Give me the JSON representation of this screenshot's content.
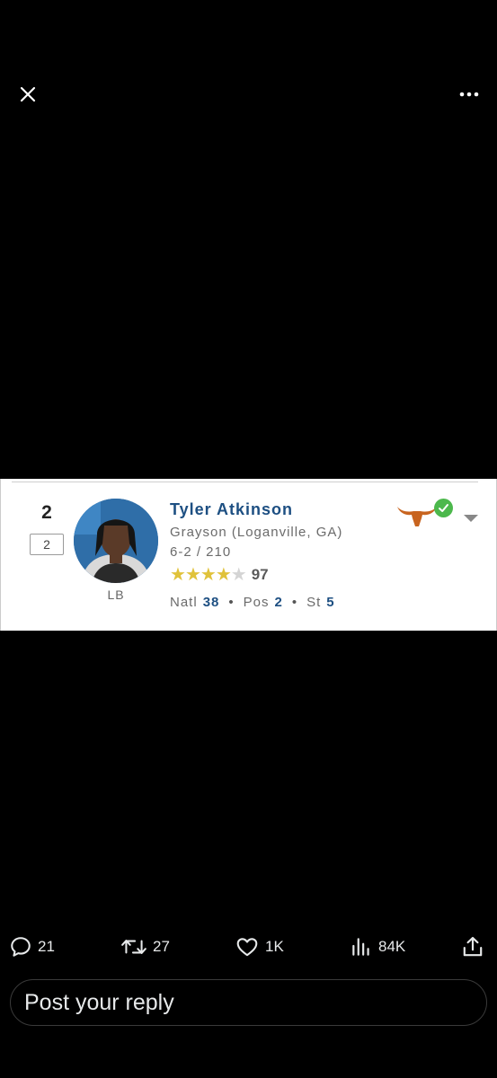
{
  "icons": {
    "close": "close-icon",
    "more": "more-horizontal-icon",
    "reply": "reply-bubble-icon",
    "retweet": "retweet-icon",
    "like": "heart-icon",
    "views": "views-bar-chart-icon",
    "share": "share-upload-icon",
    "team": "longhorn-logo-icon",
    "committed": "check-circle-icon",
    "dropdown": "caret-down-icon"
  },
  "recruit": {
    "rank": "2",
    "position_rank": "2",
    "position": "LB",
    "name": "Tyler Atkinson",
    "school": "Grayson (Loganville, GA)",
    "height_weight": "6-2 / 210",
    "stars": 4,
    "stars_total": 5,
    "rating": "97",
    "natl_label": "Natl",
    "natl_value": "38",
    "pos_label": "Pos",
    "pos_value": "2",
    "st_label": "St",
    "st_value": "5",
    "separator": "•"
  },
  "actions": {
    "replies": "21",
    "reposts": "27",
    "likes": "1K",
    "views": "84K"
  },
  "reply": {
    "placeholder": "Post your reply"
  },
  "colors": {
    "background": "#000000",
    "name_blue": "#1d4f82",
    "star_gold": "#e0c23a",
    "check_green": "#4cb84c",
    "longhorn_orange": "#c8641f"
  }
}
